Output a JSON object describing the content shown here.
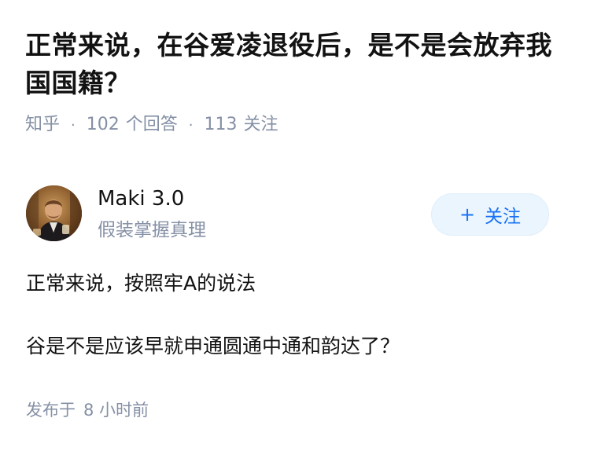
{
  "question": {
    "title": "正常来说，在谷爱凌退役后，是不是会放弃我国国籍？"
  },
  "meta": {
    "source": "知乎",
    "separator": "·",
    "answers_count": "102",
    "answers_label": "个回答",
    "followers_count": "113",
    "followers_label": "关注"
  },
  "author": {
    "name": "Maki 3.0",
    "headline": "假装掌握真理",
    "avatar_icon": "avatar-photo"
  },
  "follow_button": {
    "plus": "+",
    "label": "关注",
    "color": "#1772f6",
    "background": "#ebf5fd"
  },
  "answer": {
    "paragraphs": [
      "正常来说，按照牢A的说法",
      "谷是不是应该早就申通圆通中通和韵达了？"
    ]
  },
  "footer": {
    "publish_label": "发布于",
    "publish_time": "8 小时前"
  }
}
